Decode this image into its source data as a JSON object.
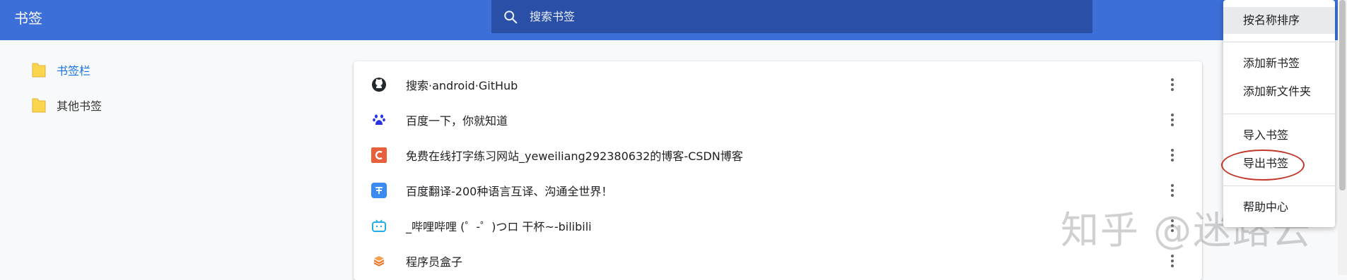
{
  "header": {
    "title": "书签",
    "search_placeholder": "搜索书签"
  },
  "sidebar": {
    "items": [
      {
        "label": "书签栏",
        "active": true
      },
      {
        "label": "其他书签",
        "active": false
      }
    ]
  },
  "bookmarks": [
    {
      "title": "搜索·android·GitHub",
      "icon": "github-icon"
    },
    {
      "title": "百度一下，你就知道",
      "icon": "baidu-paw-icon"
    },
    {
      "title": "免费在线打字练习网站_yeweiliang292380632的博客-CSDN博客",
      "icon": "csdn-c-icon"
    },
    {
      "title": "百度翻译-200种语言互译、沟通全世界！",
      "icon": "translate-icon"
    },
    {
      "title": "_哔哩哔哩 (゜-゜)つロ 干杯~-bilibili",
      "icon": "bilibili-tv-icon"
    },
    {
      "title": "程序员盒子",
      "icon": "box-icon"
    }
  ],
  "menu": {
    "items": {
      "sort": "按名称排序",
      "add_bookmark": "添加新书签",
      "add_folder": "添加新文件夹",
      "import": "导入书签",
      "export": "导出书签",
      "help": "帮助中心"
    }
  },
  "watermark": "知乎 @迷路云",
  "colors": {
    "topbar": "#3c6fd8",
    "search_bg": "#2a4fa7",
    "accent": "#1a73e8",
    "highlight_circle": "#c0392b"
  }
}
